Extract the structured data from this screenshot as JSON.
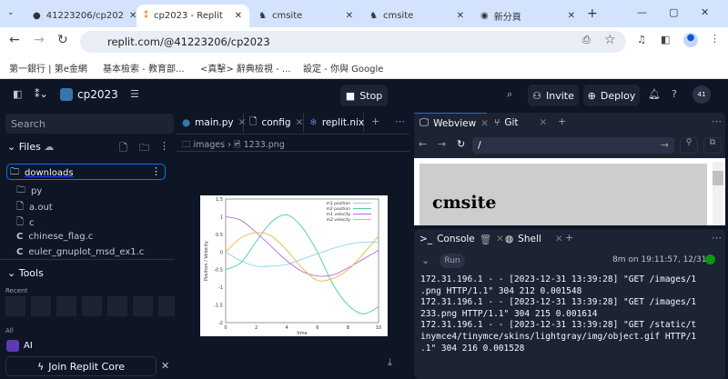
{
  "browser": {
    "tabs": [
      {
        "label": "41223206/cp202",
        "icon": "github-icon"
      },
      {
        "label": "cp2023 - Replit",
        "icon": "replit-icon",
        "active": true
      },
      {
        "label": "cmsite",
        "icon": "site-icon"
      },
      {
        "label": "cmsite",
        "icon": "site-icon"
      },
      {
        "label": "新分頁",
        "icon": "chrome-icon"
      }
    ],
    "url": "replit.com/@41223206/cp2023",
    "bookmarks": [
      "第一銀行 | 第e金網",
      "基本檢索 - 教育部...",
      "<真擊> 辭典檢視 - ...",
      "設定 - 你與 Google"
    ]
  },
  "replit": {
    "project": "cp2023",
    "stop": "Stop",
    "invite": "Invite",
    "deploy": "Deploy",
    "avatar": "41",
    "search_placeholder": "Search",
    "files_label": "Files",
    "files": [
      {
        "name": "downloads",
        "type": "folder",
        "selected": true
      },
      {
        "name": "py",
        "type": "folder"
      },
      {
        "name": "a.out",
        "type": "file"
      },
      {
        "name": "c",
        "type": "file"
      },
      {
        "name": "chinese_flag.c",
        "type": "c"
      },
      {
        "name": "euler_gnuplot_msd_ex1.c",
        "type": "c"
      }
    ],
    "tools_label": "Tools",
    "recent_label": "Recent",
    "all_label": "All",
    "ai_label": "AI",
    "join_core": "Join Replit Core",
    "editor_tabs": [
      "main.py",
      "config",
      "replit.nix"
    ],
    "breadcrumb": [
      "images",
      "1233.png"
    ],
    "image": {
      "ylabel": "Position / Velocity",
      "xlabel": "time",
      "yticks": [
        "1.5",
        "1",
        "0.5",
        "0",
        "-0.5",
        "-1",
        "-1.5",
        "-2"
      ],
      "xticks": [
        "0",
        "2",
        "4",
        "6",
        "8",
        "10"
      ],
      "series": [
        {
          "name": "m1 position",
          "color": "#8fd3f0",
          "y": [
            0,
            -0.25,
            -0.4,
            -0.4,
            -0.35,
            -0.2,
            -0.05,
            0.1,
            0.22,
            0.28,
            0.28
          ]
        },
        {
          "name": "m2 position",
          "color": "#4ecb9c",
          "y": [
            -0.5,
            -0.3,
            0.3,
            0.85,
            1.05,
            0.7,
            0,
            -0.9,
            -1.5,
            -1.75,
            -1.55
          ]
        },
        {
          "name": "m1 velocity",
          "color": "#b36ae2",
          "y": [
            1,
            0.9,
            0.55,
            0.15,
            -0.25,
            -0.55,
            -0.68,
            -0.65,
            -0.45,
            -0.2,
            0.05
          ]
        },
        {
          "name": "m2 velocity",
          "color": "#f0b44a",
          "y": [
            0,
            0.4,
            0.55,
            0.45,
            0.05,
            -0.45,
            -0.8,
            -0.75,
            -0.5,
            -0.05,
            0.45
          ]
        }
      ]
    },
    "webview_tabs": [
      "Webview",
      "Git"
    ],
    "webview_path": "/",
    "site_title": "cmsite",
    "console_tabs": [
      "Console",
      "Shell"
    ],
    "run": "Run",
    "run_status": "8m on 19:11:57, 12/31",
    "status_color": "#0a9a0a",
    "console_lines": [
      "172.31.196.1 - - [2023-12-31 13:39:28] \"GET /images/1",
      ".png HTTP/1.1\" 304 212 0.001548",
      "172.31.196.1 - - [2023-12-31 13:39:28] \"GET /images/1",
      "233.png HTTP/1.1\" 304 215 0.001614",
      "172.31.196.1 - - [2023-12-31 13:39:28] \"GET /static/t",
      "inymce4/tinymce/skins/lightgray/img/object.gif HTTP/1",
      ".1\" 304 216 0.001528"
    ]
  }
}
